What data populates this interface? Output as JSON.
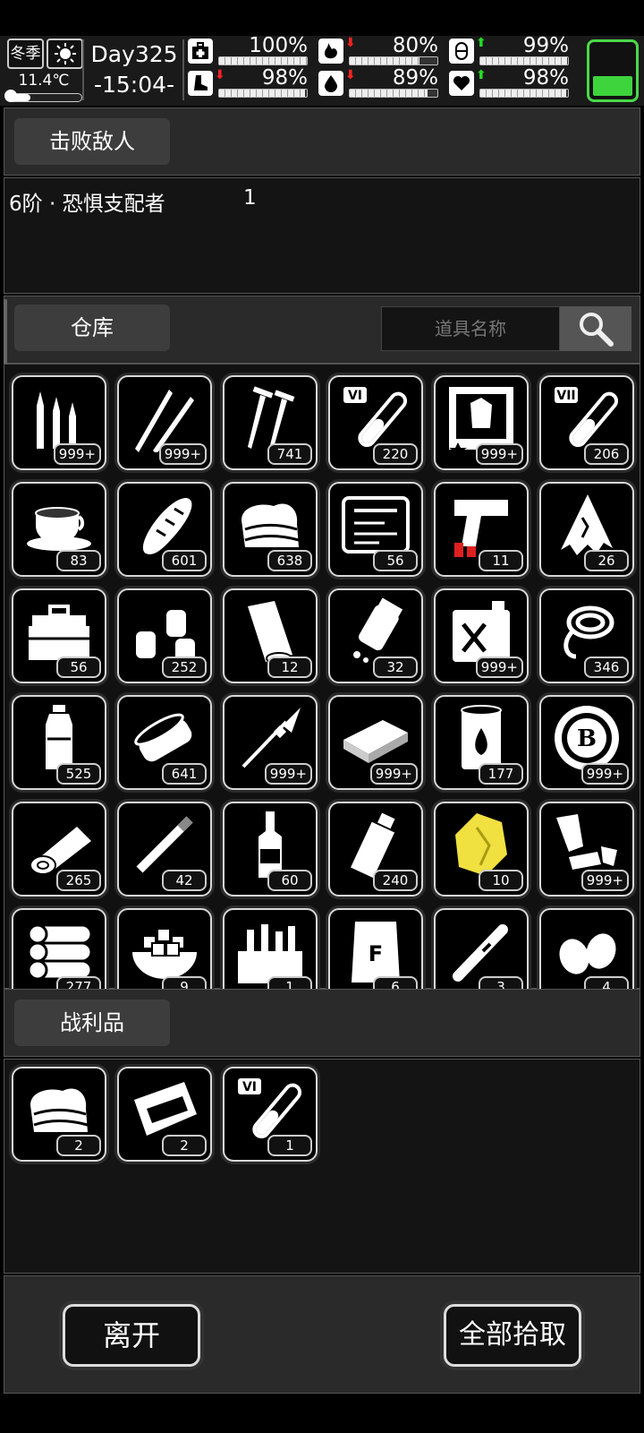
{
  "status": {
    "season": "冬季",
    "temperature": "11.4℃",
    "temperature_level": 0.3,
    "day": "Day325",
    "time": "-15:04-",
    "stats": [
      {
        "icon": "medkit-icon",
        "arrow": "",
        "value": "100%",
        "level": 1.0
      },
      {
        "icon": "stomach-icon",
        "arrow": "down",
        "value": "80%",
        "level": 0.8
      },
      {
        "icon": "pill-icon",
        "arrow": "up",
        "value": "99%",
        "level": 0.99
      },
      {
        "icon": "boot-icon",
        "arrow": "down",
        "value": "98%",
        "level": 0.98
      },
      {
        "icon": "water-drop-icon",
        "arrow": "down",
        "value": "89%",
        "level": 0.89
      },
      {
        "icon": "heart-icon",
        "arrow": "up",
        "value": "98%",
        "level": 0.98
      }
    ],
    "battery_level": 0.35,
    "colors": {
      "arrow_up": "#22dd22",
      "arrow_down": "#ff2222",
      "battery": "#3ed43e"
    }
  },
  "defeated": {
    "tab_label": "击败敌人",
    "enemy_name": "6阶 · 恐惧支配者",
    "enemy_count": "1"
  },
  "warehouse": {
    "tab_label": "仓库",
    "search_placeholder": "道具名称",
    "items": [
      {
        "icon": "rifle-bullets-icon",
        "count": "999+"
      },
      {
        "icon": "pistol-bullets-icon",
        "count": "999+"
      },
      {
        "icon": "nails-icon",
        "count": "741"
      },
      {
        "icon": "test-tube-vi-icon",
        "count": "220"
      },
      {
        "icon": "zombie-poster-icon",
        "count": "999+"
      },
      {
        "icon": "test-tube-vii-icon",
        "count": "206"
      },
      {
        "icon": "coffee-cup-icon",
        "count": "83"
      },
      {
        "icon": "bread-icon",
        "count": "601"
      },
      {
        "icon": "cloth-icon",
        "count": "638"
      },
      {
        "icon": "tool-case-icon",
        "count": "56"
      },
      {
        "icon": "flare-gun-icon",
        "count": "11"
      },
      {
        "icon": "torn-cloth-icon",
        "count": "26"
      },
      {
        "icon": "toolbox-icon",
        "count": "56"
      },
      {
        "icon": "seed-bags-icon",
        "count": "252"
      },
      {
        "icon": "paper-roll-icon",
        "count": "12"
      },
      {
        "icon": "pill-bottle-icon",
        "count": "32"
      },
      {
        "icon": "jerry-can-icon",
        "count": "999+"
      },
      {
        "icon": "rope-icon",
        "count": "346"
      },
      {
        "icon": "water-bottle-icon",
        "count": "525"
      },
      {
        "icon": "canned-food-icon",
        "count": "641"
      },
      {
        "icon": "spear-icon",
        "count": "999+"
      },
      {
        "icon": "wood-plank-icon",
        "count": "999+"
      },
      {
        "icon": "oil-barrel-icon",
        "count": "177"
      },
      {
        "icon": "bitcoin-chip-icon",
        "count": "999+"
      },
      {
        "icon": "log-icon",
        "count": "265"
      },
      {
        "icon": "cigarette-icon",
        "count": "42"
      },
      {
        "icon": "liquor-bottle-icon",
        "count": "60"
      },
      {
        "icon": "milk-bottle-icon",
        "count": "240"
      },
      {
        "icon": "gold-ore-icon",
        "count": "10"
      },
      {
        "icon": "scrap-metal-icon",
        "count": "999+"
      },
      {
        "icon": "log-pile-icon",
        "count": "277"
      },
      {
        "icon": "sugar-cubes-icon",
        "count": "9"
      },
      {
        "icon": "mech-parts-box-icon",
        "count": "1"
      },
      {
        "icon": "fertilizer-bag-icon",
        "count": "6"
      },
      {
        "icon": "cigar-icon",
        "count": "3"
      },
      {
        "icon": "eggs-icon",
        "count": "4"
      }
    ]
  },
  "loot": {
    "tab_label": "战利品",
    "items": [
      {
        "icon": "cloth-icon",
        "count": "2"
      },
      {
        "icon": "wrap-food-icon",
        "count": "2"
      },
      {
        "icon": "test-tube-vi-icon",
        "count": "1"
      }
    ]
  },
  "footer": {
    "leave_label": "离开",
    "take_all_label": "全部拾取"
  }
}
